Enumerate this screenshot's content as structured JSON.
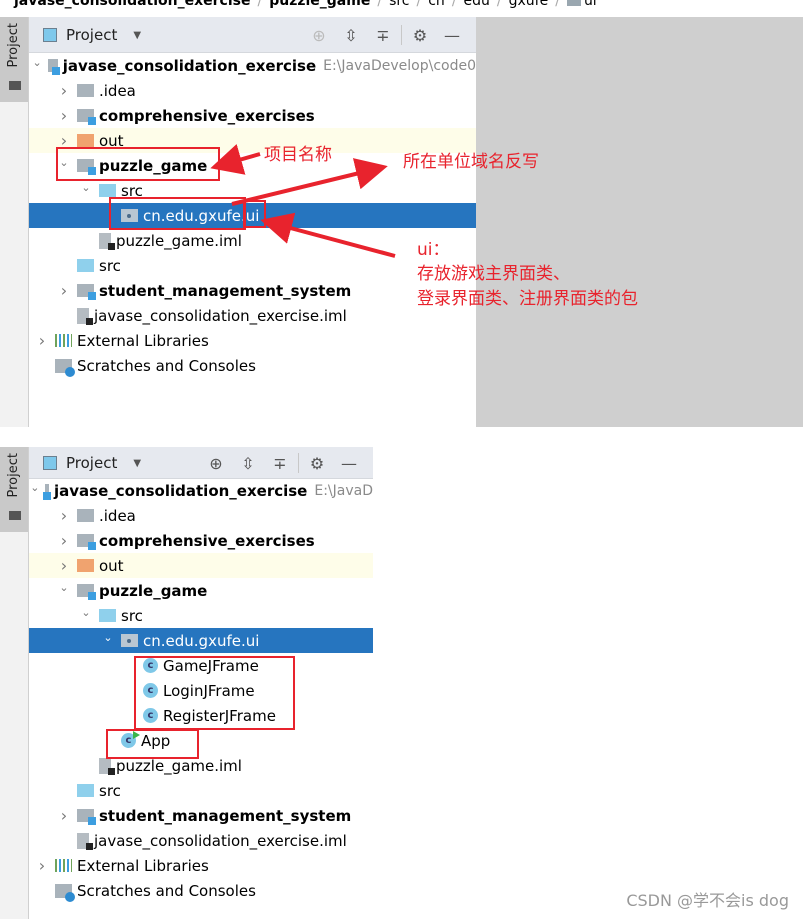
{
  "breadcrumb": [
    {
      "label": "javase_consolidation_exercise",
      "bold": true
    },
    {
      "label": "puzzle_game",
      "bold": true
    },
    {
      "label": "src"
    },
    {
      "label": "cn"
    },
    {
      "label": "edu"
    },
    {
      "label": "gxufe"
    },
    {
      "label": "ui",
      "icon": "package-icon"
    }
  ],
  "side_tab": {
    "label": "Project"
  },
  "tool_window": {
    "title": "Project",
    "dropdown_icon": "triangle-down-icon",
    "tools": [
      {
        "name": "locate-icon",
        "glyph": "⨁"
      },
      {
        "name": "expand-all-icon",
        "glyph": "⩸"
      },
      {
        "name": "collapse-all-icon",
        "glyph": "∓"
      },
      {
        "name": "gear-icon",
        "glyph": "⚙"
      },
      {
        "name": "hide-icon",
        "glyph": "—"
      }
    ]
  },
  "panel1": {
    "tree": [
      {
        "label": "javase_consolidation_exercise",
        "bold": true,
        "path": "E:\\JavaDevelop\\code0",
        "icon": "module",
        "expand": "open",
        "indent": 0
      },
      {
        "label": ".idea",
        "icon": "folder",
        "expand": "closed",
        "indent": 1
      },
      {
        "label": "comprehensive_exercises",
        "bold": true,
        "icon": "module",
        "expand": "closed",
        "indent": 1
      },
      {
        "label": "out",
        "icon": "folder-out",
        "expand": "closed",
        "indent": 1,
        "highlight": "out"
      },
      {
        "label": "puzzle_game",
        "bold": true,
        "icon": "module",
        "expand": "open",
        "indent": 1
      },
      {
        "label": "src",
        "icon": "folder-src",
        "expand": "open",
        "indent": 2
      },
      {
        "label": "cn.edu.gxufe.ui",
        "icon": "package",
        "expand": "none",
        "indent": 3,
        "selected": true
      },
      {
        "label": "puzzle_game.iml",
        "icon": "iml",
        "expand": "none",
        "indent": 2
      },
      {
        "label": "src",
        "icon": "folder-src",
        "expand": "none",
        "indent": 1
      },
      {
        "label": "student_management_system",
        "bold": true,
        "icon": "module",
        "expand": "closed",
        "indent": 1
      },
      {
        "label": "javase_consolidation_exercise.iml",
        "icon": "iml",
        "expand": "none",
        "indent": 1
      },
      {
        "label": "External Libraries",
        "icon": "libs",
        "expand": "closed",
        "indent": 0
      },
      {
        "label": "Scratches and Consoles",
        "icon": "scratch",
        "expand": "none",
        "indent": 0
      }
    ],
    "annotations": {
      "project_name": "项目名称",
      "domain_reversed": "所在单位域名反写",
      "ui_title": "ui：",
      "ui_line1": "存放游戏主界面类、",
      "ui_line2": "登录界面类、注册界面类的包"
    }
  },
  "panel2": {
    "tree": [
      {
        "label": "javase_consolidation_exercise",
        "bold": true,
        "path": "E:\\JavaD",
        "icon": "module",
        "expand": "open",
        "indent": 0
      },
      {
        "label": ".idea",
        "icon": "folder",
        "expand": "closed",
        "indent": 1
      },
      {
        "label": "comprehensive_exercises",
        "bold": true,
        "icon": "module",
        "expand": "closed",
        "indent": 1
      },
      {
        "label": "out",
        "icon": "folder-out",
        "expand": "closed",
        "indent": 1,
        "highlight": "out"
      },
      {
        "label": "puzzle_game",
        "bold": true,
        "icon": "module",
        "expand": "open",
        "indent": 1
      },
      {
        "label": "src",
        "icon": "folder-src",
        "expand": "open",
        "indent": 2
      },
      {
        "label": "cn.edu.gxufe.ui",
        "icon": "package",
        "expand": "open",
        "indent": 3,
        "selected": true
      },
      {
        "label": "GameJFrame",
        "icon": "class",
        "expand": "none",
        "indent": 4
      },
      {
        "label": "LoginJFrame",
        "icon": "class",
        "expand": "none",
        "indent": 4
      },
      {
        "label": "RegisterJFrame",
        "icon": "class",
        "expand": "none",
        "indent": 4
      },
      {
        "label": "App",
        "icon": "class-main",
        "expand": "none",
        "indent": 3
      },
      {
        "label": "puzzle_game.iml",
        "icon": "iml",
        "expand": "none",
        "indent": 2
      },
      {
        "label": "src",
        "icon": "folder-src",
        "expand": "none",
        "indent": 1
      },
      {
        "label": "student_management_system",
        "bold": true,
        "icon": "module",
        "expand": "closed",
        "indent": 1
      },
      {
        "label": "javase_consolidation_exercise.iml",
        "icon": "iml",
        "expand": "none",
        "indent": 1
      },
      {
        "label": "External Libraries",
        "icon": "libs",
        "expand": "closed",
        "indent": 0
      },
      {
        "label": "Scratches and Consoles",
        "icon": "scratch",
        "expand": "none",
        "indent": 0
      }
    ]
  },
  "colors": {
    "selection": "#2675bf",
    "annotation_red": "#e8232d",
    "out_row_bg": "#fefde9",
    "header_bg": "#e6e9ef"
  },
  "watermark": "CSDN @学不会is dog"
}
